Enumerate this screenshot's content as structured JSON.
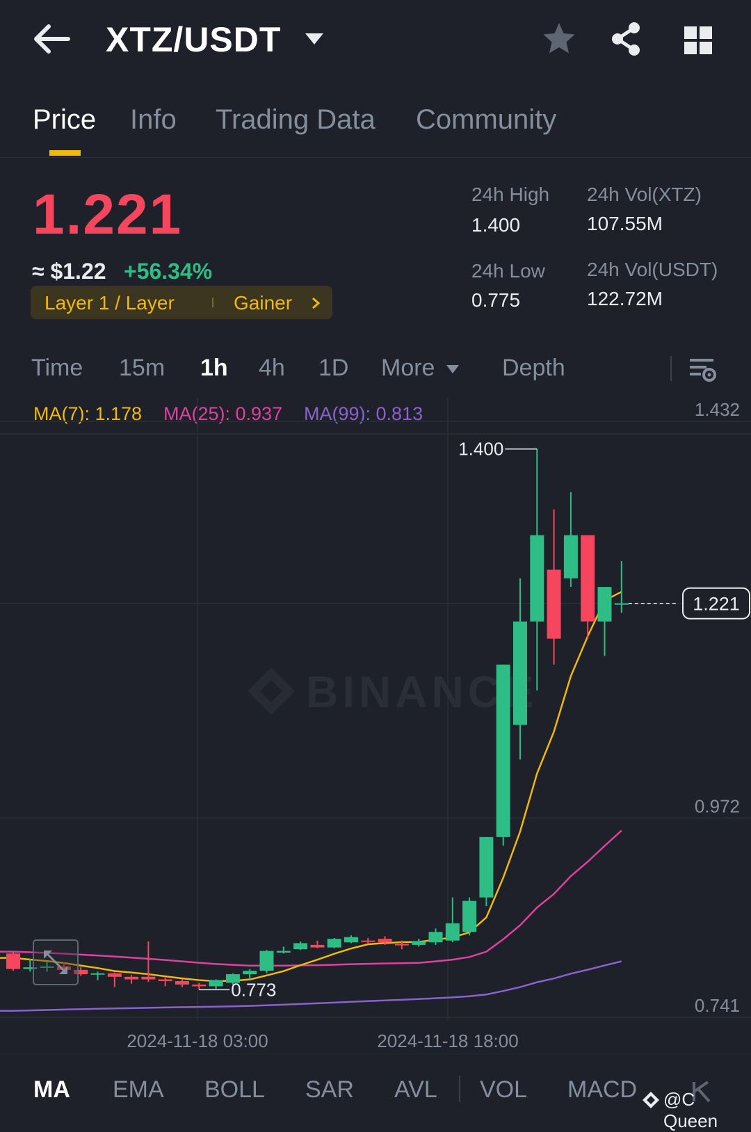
{
  "header": {
    "pair": "XTZ/USDT",
    "icons": {
      "back": "back-arrow-icon",
      "dropdown": "caret-down-icon",
      "favorite": "star-icon",
      "share": "share-icon",
      "apps": "grid-icon"
    }
  },
  "tabs": [
    {
      "label": "Price",
      "active": true
    },
    {
      "label": "Info",
      "active": false
    },
    {
      "label": "Trading Data",
      "active": false
    },
    {
      "label": "Community",
      "active": false
    }
  ],
  "price": {
    "last": "1.221",
    "usd": "≈ $1.22",
    "change": "+56.34%",
    "tag_left": "Layer 1 / Layer",
    "tag_right": "Gainer"
  },
  "stats": {
    "high_label": "24h High",
    "high_value": "1.400",
    "low_label": "24h Low",
    "low_value": "0.775",
    "vol_base_label": "24h Vol(XTZ)",
    "vol_base_value": "107.55M",
    "vol_quote_label": "24h Vol(USDT)",
    "vol_quote_value": "122.72M"
  },
  "timeframes": [
    {
      "label": "Time",
      "active": false
    },
    {
      "label": "15m",
      "active": false
    },
    {
      "label": "1h",
      "active": true
    },
    {
      "label": "4h",
      "active": false
    },
    {
      "label": "1D",
      "active": false
    },
    {
      "label": "More",
      "active": false
    },
    {
      "label": "Depth",
      "active": false
    }
  ],
  "ma_legend": {
    "ma7": "MA(7): 1.178",
    "ma25": "MA(25): 0.937",
    "ma99": "MA(99): 0.813"
  },
  "colors": {
    "up": "#2ebd85",
    "down": "#f6465d",
    "accent": "#f0b90b",
    "ma7": "#f0b90b",
    "ma25": "#e040a0",
    "ma99": "#8a62d0",
    "background": "#1e2129"
  },
  "chart_data": {
    "type": "candlestick",
    "y_ticks": [
      "1.432",
      "0.972",
      "0.741"
    ],
    "ylim": [
      0.733,
      1.432
    ],
    "x_ticks": [
      "2024-11-18 03:00",
      "2024-11-18 18:00"
    ],
    "brand_watermark": "BINANCE",
    "high_label": "1.400",
    "low_label": "0.773",
    "current_price_label": "1.221",
    "candles": [
      [
        0.815,
        0.817,
        0.795,
        0.797
      ],
      [
        0.797,
        0.809,
        0.794,
        0.799
      ],
      [
        0.799,
        0.805,
        0.794,
        0.8
      ],
      [
        0.8,
        0.805,
        0.793,
        0.796
      ],
      [
        0.796,
        0.799,
        0.789,
        0.791
      ],
      [
        0.791,
        0.794,
        0.784,
        0.792
      ],
      [
        0.792,
        0.793,
        0.776,
        0.788
      ],
      [
        0.788,
        0.79,
        0.78,
        0.785
      ],
      [
        0.788,
        0.829,
        0.782,
        0.785
      ],
      [
        0.785,
        0.787,
        0.777,
        0.783
      ],
      [
        0.783,
        0.785,
        0.776,
        0.779
      ],
      [
        0.779,
        0.781,
        0.773,
        0.777
      ],
      [
        0.777,
        0.785,
        0.774,
        0.784
      ],
      [
        0.781,
        0.792,
        0.779,
        0.791
      ],
      [
        0.791,
        0.797,
        0.785,
        0.795
      ],
      [
        0.795,
        0.819,
        0.792,
        0.818
      ],
      [
        0.816,
        0.823,
        0.815,
        0.818
      ],
      [
        0.82,
        0.829,
        0.819,
        0.827
      ],
      [
        0.825,
        0.83,
        0.821,
        0.822
      ],
      [
        0.822,
        0.833,
        0.821,
        0.832
      ],
      [
        0.828,
        0.836,
        0.827,
        0.834
      ],
      [
        0.83,
        0.833,
        0.827,
        0.829
      ],
      [
        0.832,
        0.835,
        0.825,
        0.828
      ],
      [
        0.826,
        0.83,
        0.82,
        0.825
      ],
      [
        0.825,
        0.832,
        0.823,
        0.829
      ],
      [
        0.828,
        0.844,
        0.825,
        0.84
      ],
      [
        0.83,
        0.88,
        0.828,
        0.85
      ],
      [
        0.84,
        0.88,
        0.836,
        0.876
      ],
      [
        0.88,
        0.95,
        0.87,
        0.95
      ],
      [
        0.95,
        1.15,
        0.94,
        1.15
      ],
      [
        1.08,
        1.25,
        1.04,
        1.2
      ],
      [
        1.2,
        1.4,
        1.12,
        1.3
      ],
      [
        1.26,
        1.33,
        1.15,
        1.18
      ],
      [
        1.25,
        1.35,
        1.24,
        1.3
      ],
      [
        1.3,
        1.3,
        1.18,
        1.2
      ],
      [
        1.2,
        1.24,
        1.16,
        1.24
      ],
      [
        1.22,
        1.27,
        1.21,
        1.221
      ]
    ]
  },
  "indicators": [
    {
      "label": "MA",
      "active": true
    },
    {
      "label": "EMA",
      "active": false
    },
    {
      "label": "BOLL",
      "active": false
    },
    {
      "label": "SAR",
      "active": false
    },
    {
      "label": "AVL",
      "active": false
    },
    {
      "label": "VOL",
      "active": false
    },
    {
      "label": "MACD",
      "active": false
    }
  ],
  "watermark": "@C Queen"
}
